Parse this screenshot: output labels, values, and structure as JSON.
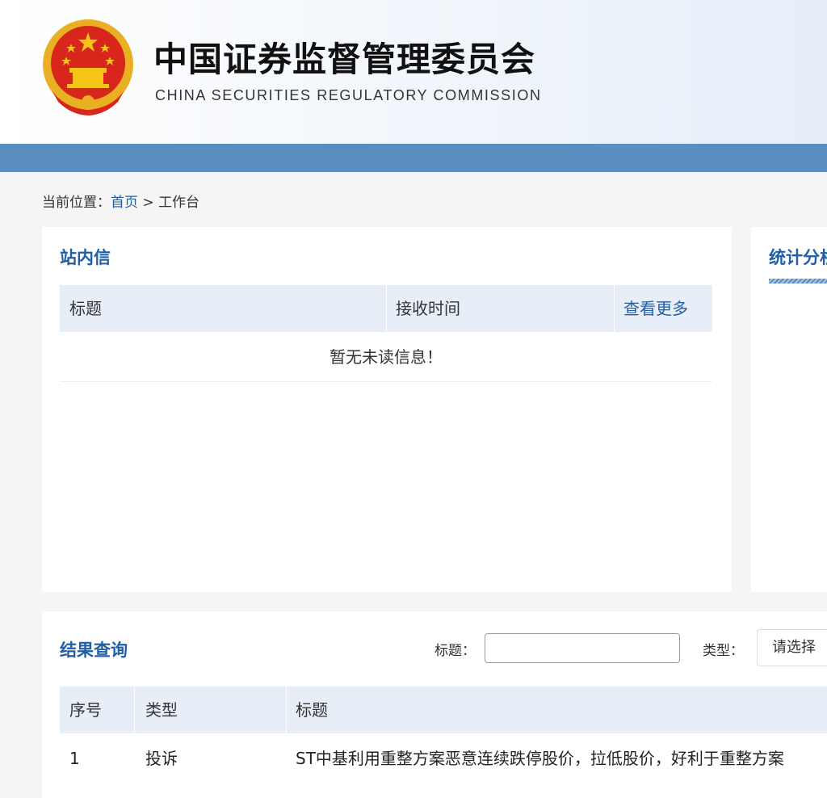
{
  "header": {
    "title_cn": "中国证券监督管理委员会",
    "title_en": "CHINA SECURITIES REGULATORY COMMISSION",
    "emblem_icon": "national-emblem-icon"
  },
  "breadcrumb": {
    "prefix": "当前位置：",
    "home": "首页",
    "separator": " > ",
    "current": "工作台"
  },
  "messages": {
    "title": "站内信",
    "columns": [
      "标题",
      "接收时间"
    ],
    "more_link": "查看更多",
    "empty_text": "暂无未读信息！"
  },
  "stats": {
    "title": "统计分析"
  },
  "results": {
    "title": "结果查询",
    "filter_title_label": "标题：",
    "filter_title_value": "",
    "filter_type_label": "类型：",
    "filter_type_value": "请选择",
    "columns": [
      "序号",
      "类型",
      "标题"
    ],
    "rows": [
      {
        "index": "1",
        "type": "投诉",
        "title": "ST中基利用重整方案恶意连续跌停股价，拉低股价，好利于重整方案"
      }
    ]
  },
  "colors": {
    "brand_blue": "#1f5fa8",
    "nav_bar": "#5b8ec0",
    "table_header": "#e8eef7"
  }
}
